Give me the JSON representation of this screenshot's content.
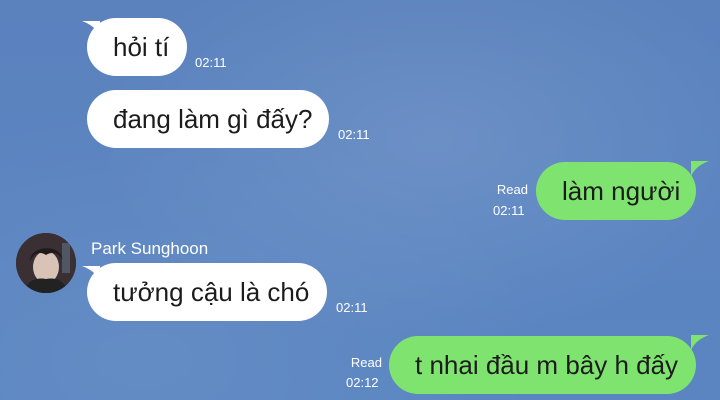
{
  "chat": {
    "messages": [
      {
        "text": "hỏi tí",
        "time": "02:11"
      },
      {
        "text": "đang làm gì đấy?",
        "time": "02:11"
      },
      {
        "text": "làm người",
        "time": "02:11",
        "status": "Read"
      },
      {
        "sender": "Park Sunghoon",
        "text": "tưởng cậu là chó",
        "time": "02:11"
      },
      {
        "text": "t nhai đầu m bây h đấy",
        "time": "02:12",
        "status": "Read"
      }
    ]
  },
  "colors": {
    "background": "#5b84c0",
    "incoming_bubble": "#ffffff",
    "outgoing_bubble": "#7ee46f",
    "meta_text": "#ffffff"
  },
  "icons": {
    "avatar": "avatar"
  }
}
